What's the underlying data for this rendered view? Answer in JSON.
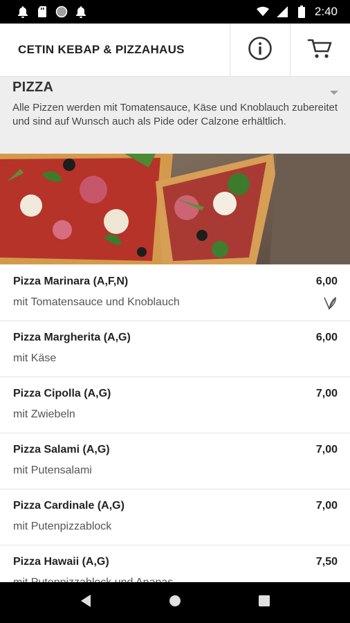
{
  "status_bar": {
    "time": "2:40",
    "icons_left": [
      "notification-bell-icon",
      "sd-card-icon",
      "circle-icon",
      "notification-bell-icon"
    ],
    "icons_right": [
      "wifi-icon",
      "signal-icon",
      "battery-icon"
    ]
  },
  "app_bar": {
    "title": "CETIN KEBAP & PIZZAHAUS",
    "actions": [
      "info-icon",
      "cart-icon"
    ]
  },
  "category": {
    "title": "PIZZA",
    "description": "Alle Pizzen werden mit Tomatensauce, Käse und Knoblauch zubereitet und sind auf Wunsch auch als Pide oder Calzone erhältlich.",
    "image": "pizza-photo"
  },
  "items": [
    {
      "name": "Pizza Marinara (A,F,N)",
      "price": "6,00",
      "description": "mit Tomatensauce und Knoblauch",
      "badge": "vegetarian-leaf-icon"
    },
    {
      "name": "Pizza Margherita (A,G)",
      "price": "6,00",
      "description": "mit Käse"
    },
    {
      "name": "Pizza Cipolla (A,G)",
      "price": "7,00",
      "description": "mit Zwiebeln"
    },
    {
      "name": "Pizza Salami (A,G)",
      "price": "7,00",
      "description": "mit Putensalami"
    },
    {
      "name": "Pizza Cardinale (A,G)",
      "price": "7,00",
      "description": "mit Putenpizzablock"
    },
    {
      "name": "Pizza Hawaii (A,G)",
      "price": "7,50",
      "description": "mit Putenpizzablock und Ananas"
    }
  ],
  "nav_bar": {
    "buttons": [
      "back-icon",
      "home-icon",
      "recents-icon"
    ]
  },
  "colors": {
    "status_bar": "#000000",
    "category_bg": "#eeeeee",
    "divider": "#e3e3e3"
  }
}
